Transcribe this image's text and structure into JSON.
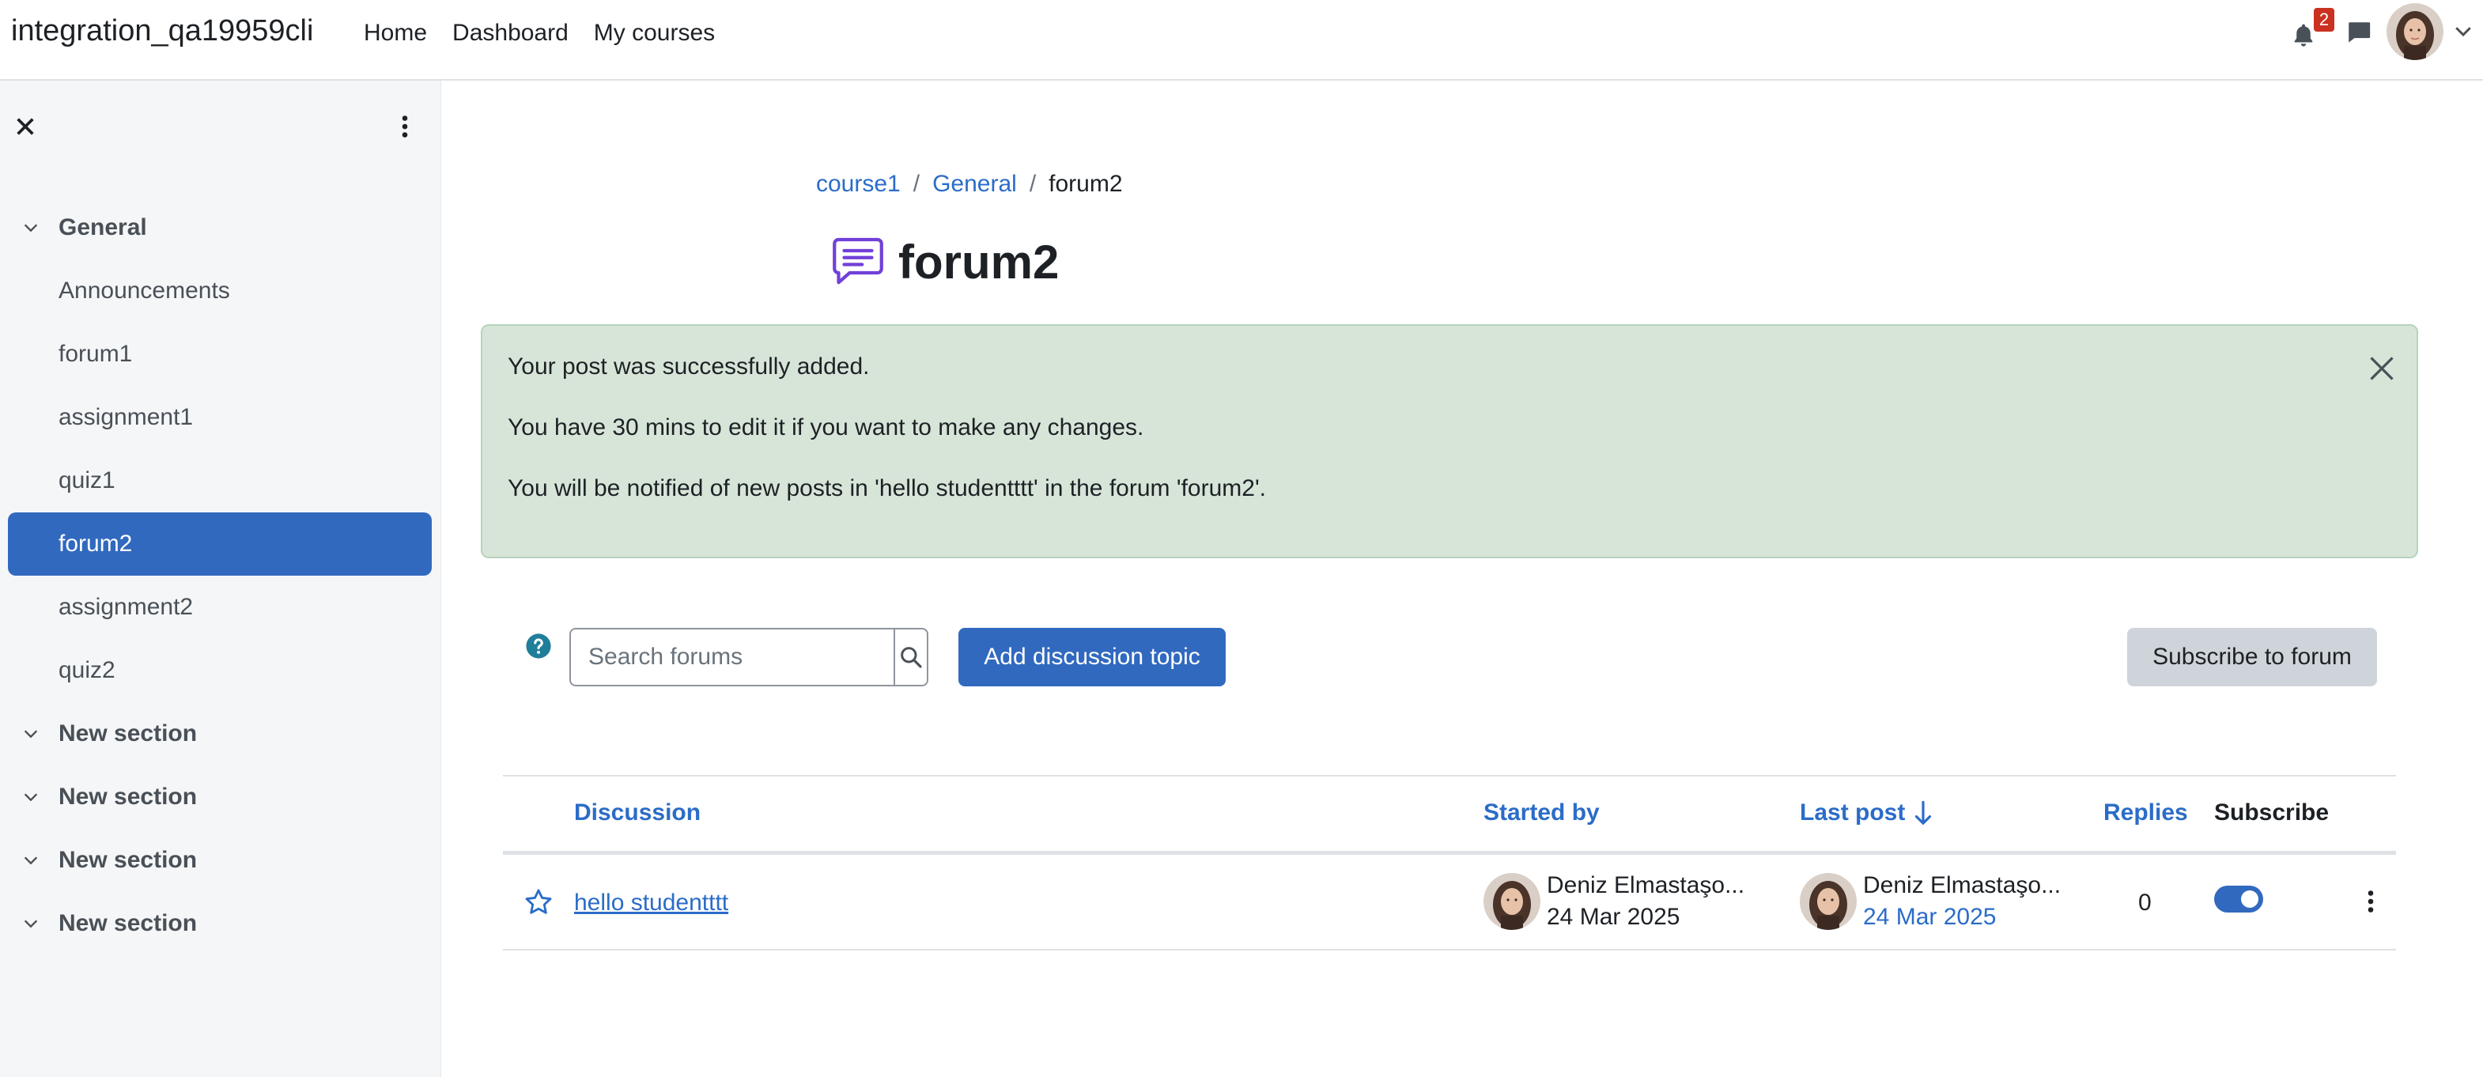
{
  "navbar": {
    "site_name": "integration_qa19959cli",
    "links": [
      "Home",
      "Dashboard",
      "My courses"
    ],
    "notification_count": "2"
  },
  "drawer": {
    "sections": [
      {
        "title": "General",
        "items": [
          "Announcements",
          "forum1",
          "assignment1",
          "quiz1",
          "forum2",
          "assignment2",
          "quiz2"
        ],
        "active_item": "forum2"
      },
      {
        "title": "New section",
        "items": []
      },
      {
        "title": "New section",
        "items": []
      },
      {
        "title": "New section",
        "items": []
      },
      {
        "title": "New section",
        "items": []
      }
    ]
  },
  "breadcrumb": {
    "items": [
      "course1",
      "General"
    ],
    "separator": "/",
    "current": "forum2"
  },
  "page": {
    "title": "forum2"
  },
  "alert": {
    "lines": [
      "Your post was successfully added.",
      "You have 30 mins to edit it if you want to make any changes.",
      "You will be notified of new posts in 'hello studentttt' in the forum 'forum2'."
    ]
  },
  "toolbar": {
    "search_placeholder": "Search forums",
    "add_label": "Add discussion topic",
    "subscribe_label": "Subscribe to forum"
  },
  "table": {
    "headers": {
      "discussion": "Discussion",
      "started_by": "Started by",
      "last_post": "Last post",
      "replies": "Replies",
      "subscribe": "Subscribe"
    },
    "rows": [
      {
        "title": "hello studentttt",
        "started_by_name": "Deniz Elmastaşo...",
        "started_by_date": "24 Mar 2025",
        "last_post_name": "Deniz Elmastaşo...",
        "last_post_date": "24 Mar 2025",
        "replies": "0",
        "subscribed": true,
        "starred": false
      }
    ]
  },
  "colors": {
    "primary": "#3169bf",
    "link": "#2b6cc8",
    "alert_bg": "#d7e5d9",
    "badge": "#ca3120",
    "drawer_bg": "#f5f6f7"
  },
  "icons": {
    "bell": "bell-icon",
    "message": "chat-bubble-icon",
    "forum": "forum-chat-icon",
    "search": "search-icon",
    "help": "question-circle-icon",
    "star": "star-outline-icon",
    "close": "close-icon",
    "kebab": "kebab-vertical-icon"
  }
}
